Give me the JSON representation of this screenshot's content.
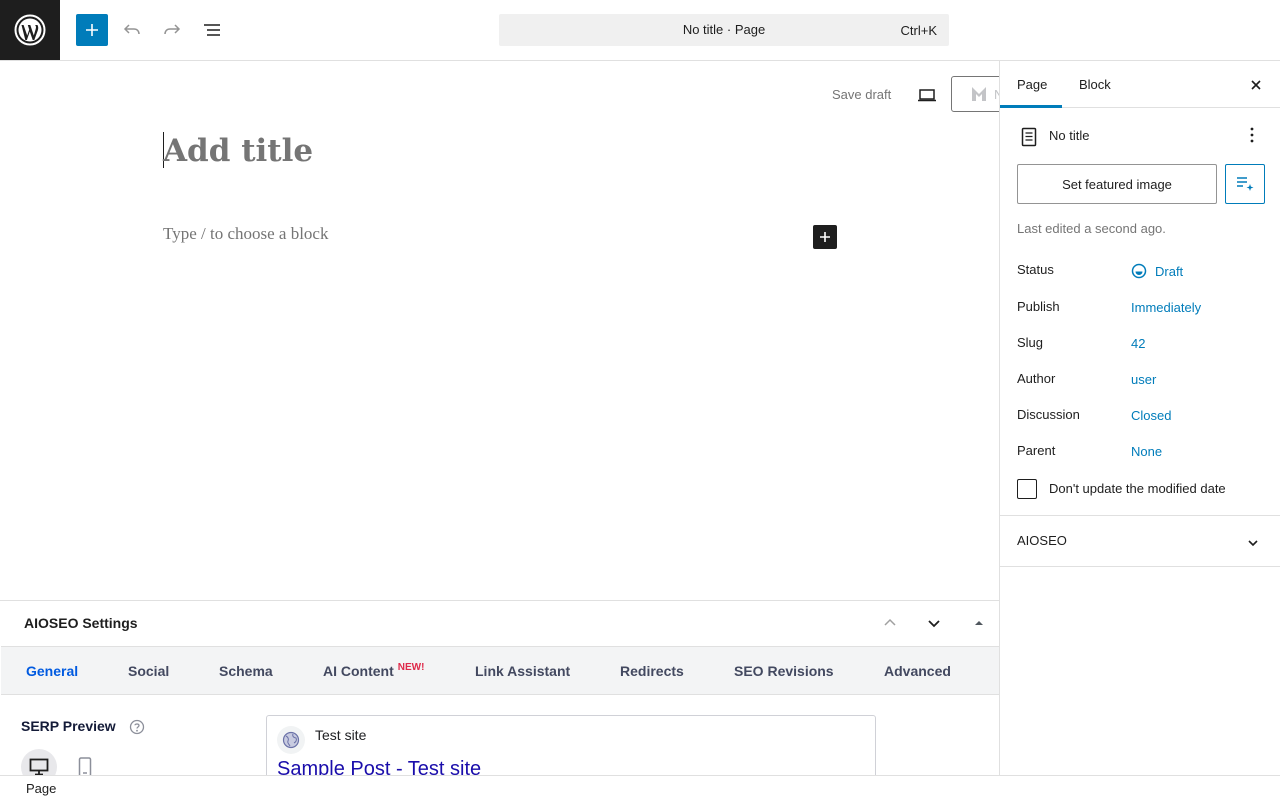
{
  "header": {
    "command_title": "No title · Page",
    "command_shortcut": "Ctrl+K"
  },
  "editor": {
    "save_draft": "Save draft",
    "aioseo_button_text": "N",
    "title_placeholder": "Add title",
    "block_placeholder": "Type / to choose a block"
  },
  "metabox": {
    "title": "AIOSEO Settings",
    "tabs": [
      {
        "label": "General"
      },
      {
        "label": "Social"
      },
      {
        "label": "Schema"
      },
      {
        "label": "AI Content",
        "badge": "NEW!"
      },
      {
        "label": "Link Assistant"
      },
      {
        "label": "Redirects"
      },
      {
        "label": "SEO Revisions"
      },
      {
        "label": "Advanced"
      }
    ],
    "serp_label": "SERP Preview",
    "serp_site": "Test site",
    "serp_title": "Sample Post - Test site"
  },
  "sidebar": {
    "tabs": [
      "Page",
      "Block"
    ],
    "doc_title": "No title",
    "featured_image_button": "Set featured image",
    "last_edited": "Last edited a second ago.",
    "meta": [
      {
        "label": "Status",
        "value": "Draft"
      },
      {
        "label": "Publish",
        "value": "Immediately"
      },
      {
        "label": "Slug",
        "value": "42"
      },
      {
        "label": "Author",
        "value": "user"
      },
      {
        "label": "Discussion",
        "value": "Closed"
      },
      {
        "label": "Parent",
        "value": "None"
      }
    ],
    "checkbox_label": "Don't update the modified date",
    "aioseo_panel": "AIOSEO"
  },
  "statusbar": {
    "breadcrumb": "Page"
  },
  "colors": {
    "accent": "#007cba",
    "aioseo_blue": "#005ae0",
    "new_badge": "#df2a4a",
    "serp_link": "#1a0dab"
  },
  "icons": {
    "logo": "wordpress-logo",
    "add": "plus-icon",
    "undo": "undo-icon",
    "redo": "redo-icon",
    "outline": "document-overview-icon",
    "preview": "laptop-icon",
    "close": "close-icon",
    "page": "page-icon",
    "more": "more-vertical-icon",
    "ai": "ai-list-icon",
    "status": "draft-status-icon"
  }
}
